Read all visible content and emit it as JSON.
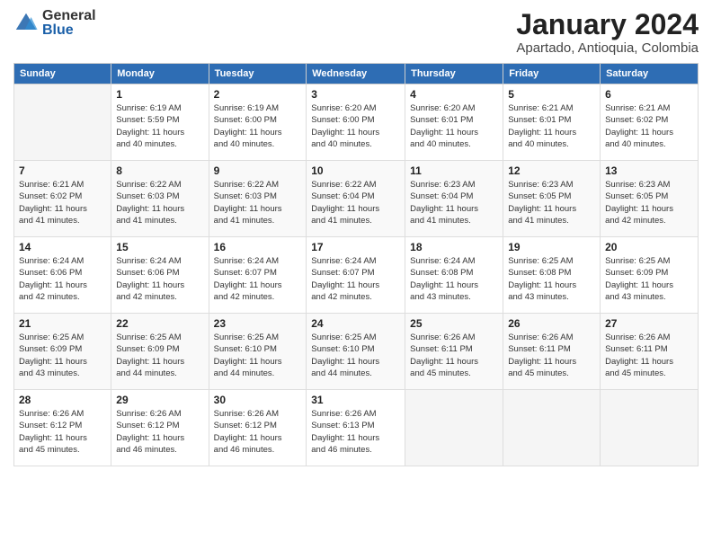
{
  "logo": {
    "general": "General",
    "blue": "Blue"
  },
  "title": "January 2024",
  "subtitle": "Apartado, Antioquia, Colombia",
  "header_days": [
    "Sunday",
    "Monday",
    "Tuesday",
    "Wednesday",
    "Thursday",
    "Friday",
    "Saturday"
  ],
  "weeks": [
    [
      {
        "day": "",
        "info": ""
      },
      {
        "day": "1",
        "info": "Sunrise: 6:19 AM\nSunset: 5:59 PM\nDaylight: 11 hours\nand 40 minutes."
      },
      {
        "day": "2",
        "info": "Sunrise: 6:19 AM\nSunset: 6:00 PM\nDaylight: 11 hours\nand 40 minutes."
      },
      {
        "day": "3",
        "info": "Sunrise: 6:20 AM\nSunset: 6:00 PM\nDaylight: 11 hours\nand 40 minutes."
      },
      {
        "day": "4",
        "info": "Sunrise: 6:20 AM\nSunset: 6:01 PM\nDaylight: 11 hours\nand 40 minutes."
      },
      {
        "day": "5",
        "info": "Sunrise: 6:21 AM\nSunset: 6:01 PM\nDaylight: 11 hours\nand 40 minutes."
      },
      {
        "day": "6",
        "info": "Sunrise: 6:21 AM\nSunset: 6:02 PM\nDaylight: 11 hours\nand 40 minutes."
      }
    ],
    [
      {
        "day": "7",
        "info": "Sunrise: 6:21 AM\nSunset: 6:02 PM\nDaylight: 11 hours\nand 41 minutes."
      },
      {
        "day": "8",
        "info": "Sunrise: 6:22 AM\nSunset: 6:03 PM\nDaylight: 11 hours\nand 41 minutes."
      },
      {
        "day": "9",
        "info": "Sunrise: 6:22 AM\nSunset: 6:03 PM\nDaylight: 11 hours\nand 41 minutes."
      },
      {
        "day": "10",
        "info": "Sunrise: 6:22 AM\nSunset: 6:04 PM\nDaylight: 11 hours\nand 41 minutes."
      },
      {
        "day": "11",
        "info": "Sunrise: 6:23 AM\nSunset: 6:04 PM\nDaylight: 11 hours\nand 41 minutes."
      },
      {
        "day": "12",
        "info": "Sunrise: 6:23 AM\nSunset: 6:05 PM\nDaylight: 11 hours\nand 41 minutes."
      },
      {
        "day": "13",
        "info": "Sunrise: 6:23 AM\nSunset: 6:05 PM\nDaylight: 11 hours\nand 42 minutes."
      }
    ],
    [
      {
        "day": "14",
        "info": "Sunrise: 6:24 AM\nSunset: 6:06 PM\nDaylight: 11 hours\nand 42 minutes."
      },
      {
        "day": "15",
        "info": "Sunrise: 6:24 AM\nSunset: 6:06 PM\nDaylight: 11 hours\nand 42 minutes."
      },
      {
        "day": "16",
        "info": "Sunrise: 6:24 AM\nSunset: 6:07 PM\nDaylight: 11 hours\nand 42 minutes."
      },
      {
        "day": "17",
        "info": "Sunrise: 6:24 AM\nSunset: 6:07 PM\nDaylight: 11 hours\nand 42 minutes."
      },
      {
        "day": "18",
        "info": "Sunrise: 6:24 AM\nSunset: 6:08 PM\nDaylight: 11 hours\nand 43 minutes."
      },
      {
        "day": "19",
        "info": "Sunrise: 6:25 AM\nSunset: 6:08 PM\nDaylight: 11 hours\nand 43 minutes."
      },
      {
        "day": "20",
        "info": "Sunrise: 6:25 AM\nSunset: 6:09 PM\nDaylight: 11 hours\nand 43 minutes."
      }
    ],
    [
      {
        "day": "21",
        "info": "Sunrise: 6:25 AM\nSunset: 6:09 PM\nDaylight: 11 hours\nand 43 minutes."
      },
      {
        "day": "22",
        "info": "Sunrise: 6:25 AM\nSunset: 6:09 PM\nDaylight: 11 hours\nand 44 minutes."
      },
      {
        "day": "23",
        "info": "Sunrise: 6:25 AM\nSunset: 6:10 PM\nDaylight: 11 hours\nand 44 minutes."
      },
      {
        "day": "24",
        "info": "Sunrise: 6:25 AM\nSunset: 6:10 PM\nDaylight: 11 hours\nand 44 minutes."
      },
      {
        "day": "25",
        "info": "Sunrise: 6:26 AM\nSunset: 6:11 PM\nDaylight: 11 hours\nand 45 minutes."
      },
      {
        "day": "26",
        "info": "Sunrise: 6:26 AM\nSunset: 6:11 PM\nDaylight: 11 hours\nand 45 minutes."
      },
      {
        "day": "27",
        "info": "Sunrise: 6:26 AM\nSunset: 6:11 PM\nDaylight: 11 hours\nand 45 minutes."
      }
    ],
    [
      {
        "day": "28",
        "info": "Sunrise: 6:26 AM\nSunset: 6:12 PM\nDaylight: 11 hours\nand 45 minutes."
      },
      {
        "day": "29",
        "info": "Sunrise: 6:26 AM\nSunset: 6:12 PM\nDaylight: 11 hours\nand 46 minutes."
      },
      {
        "day": "30",
        "info": "Sunrise: 6:26 AM\nSunset: 6:12 PM\nDaylight: 11 hours\nand 46 minutes."
      },
      {
        "day": "31",
        "info": "Sunrise: 6:26 AM\nSunset: 6:13 PM\nDaylight: 11 hours\nand 46 minutes."
      },
      {
        "day": "",
        "info": ""
      },
      {
        "day": "",
        "info": ""
      },
      {
        "day": "",
        "info": ""
      }
    ]
  ]
}
